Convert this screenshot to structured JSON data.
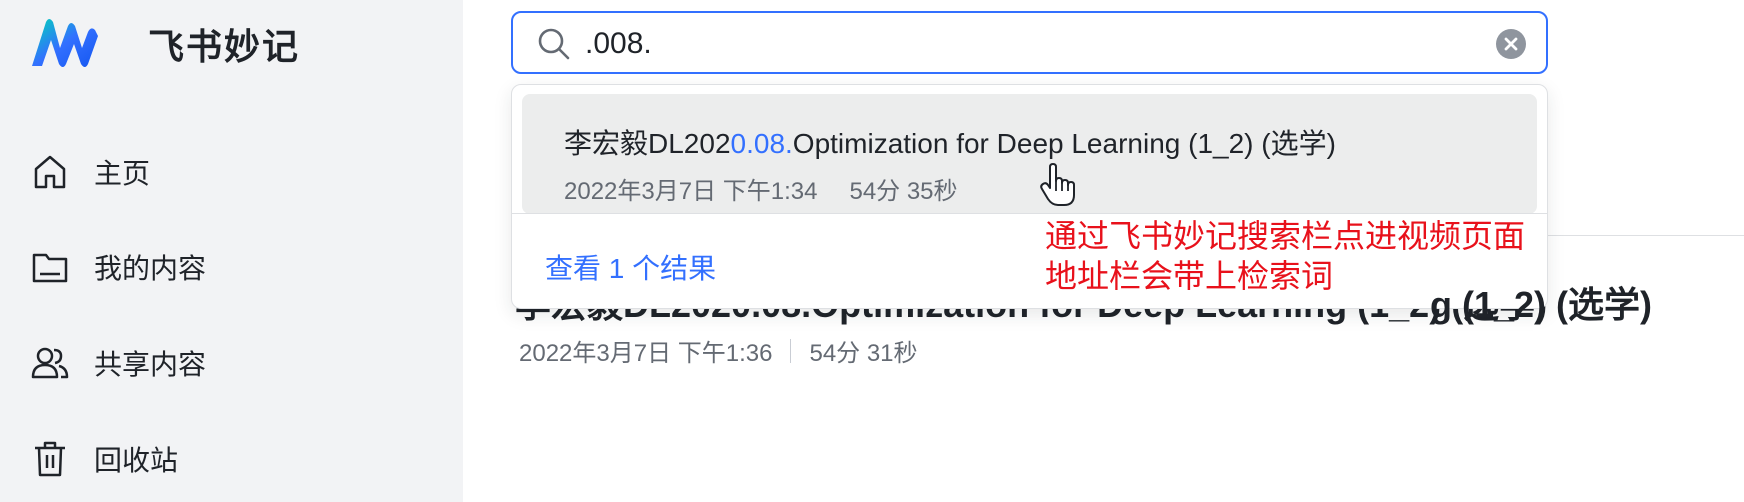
{
  "app": {
    "name": "飞书妙记"
  },
  "sidebar": {
    "items": [
      {
        "label": "主页",
        "icon": "home-icon"
      },
      {
        "label": "我的内容",
        "icon": "folder-icon"
      },
      {
        "label": "共享内容",
        "icon": "users-icon"
      },
      {
        "label": "回收站",
        "icon": "trash-icon"
      }
    ]
  },
  "search": {
    "value": ".008."
  },
  "dropdown": {
    "result": {
      "title_before": "李宏毅DL202",
      "title_match": "0.08.",
      "title_after": "Optimization for Deep Learning (1_2) (选学)",
      "date": "2022年3月7日 下午1:34",
      "duration": "54分 35秒"
    },
    "view_all": "查看 1 个结果"
  },
  "background_page": {
    "title_visible": "李宏毅DL2020.08.Optimization for Deep Learning (1_2) (选学)",
    "title_tail": "g (1_2) (选学)",
    "date": "2022年3月7日 下午1:36",
    "duration": "54分 31秒"
  },
  "annotation": {
    "line1": "通过飞书妙记搜索栏点进视频页面",
    "line2": "地址栏会带上检索词"
  },
  "colors": {
    "accent": "#3370ff",
    "sidebar_bg": "#f2f3f5",
    "annotation": "#e8111b",
    "highlight_row": "#eceded"
  }
}
